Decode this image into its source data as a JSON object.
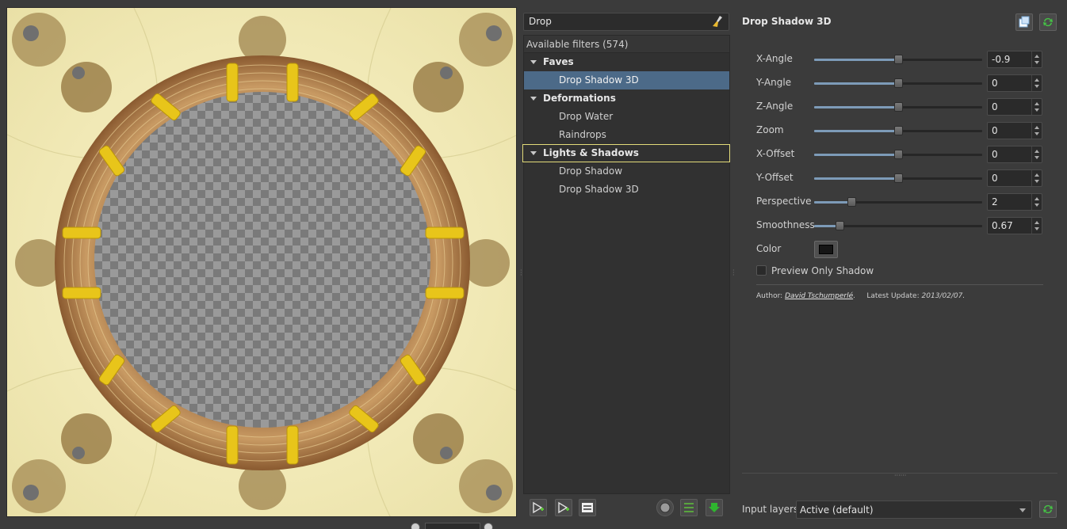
{
  "search": {
    "value": "Drop"
  },
  "filters": {
    "header": "Available filters (574)",
    "categories": [
      {
        "label": "Faves",
        "items": [
          "Drop Shadow 3D"
        ]
      },
      {
        "label": "Deformations",
        "items": [
          "Drop Water",
          "Raindrops"
        ]
      },
      {
        "label": "Lights & Shadows",
        "items": [
          "Drop Shadow",
          "Drop Shadow 3D"
        ]
      }
    ],
    "selected_item": "Drop Shadow 3D"
  },
  "params": {
    "title": "Drop Shadow 3D",
    "sliders": [
      {
        "label": "X-Angle",
        "value": "-0.9",
        "position": 0.5
      },
      {
        "label": "Y-Angle",
        "value": "0",
        "position": 0.5
      },
      {
        "label": "Z-Angle",
        "value": "0",
        "position": 0.5
      },
      {
        "label": "Zoom",
        "value": "0",
        "position": 0.5
      },
      {
        "label": "X-Offset",
        "value": "0",
        "position": 0.5
      },
      {
        "label": "Y-Offset",
        "value": "0",
        "position": 0.5
      },
      {
        "label": "Perspective",
        "value": "2",
        "position": 0.22
      },
      {
        "label": "Smoothness",
        "value": "0.67",
        "position": 0.15
      }
    ],
    "color_label": "Color",
    "color_value": "#161616",
    "checkbox_label": "Preview Only Shadow",
    "author_prefix": "Author:",
    "author_name": "David Tschumperlé",
    "update_prefix": "Latest Update:",
    "update_date": "2013/02/07."
  },
  "input_layers": {
    "label": "Input layers",
    "value": "Active (default)"
  },
  "colors": {
    "accent": "#4c6a88",
    "focus": "#e3dc7a",
    "slider": "#7d9bb8"
  }
}
